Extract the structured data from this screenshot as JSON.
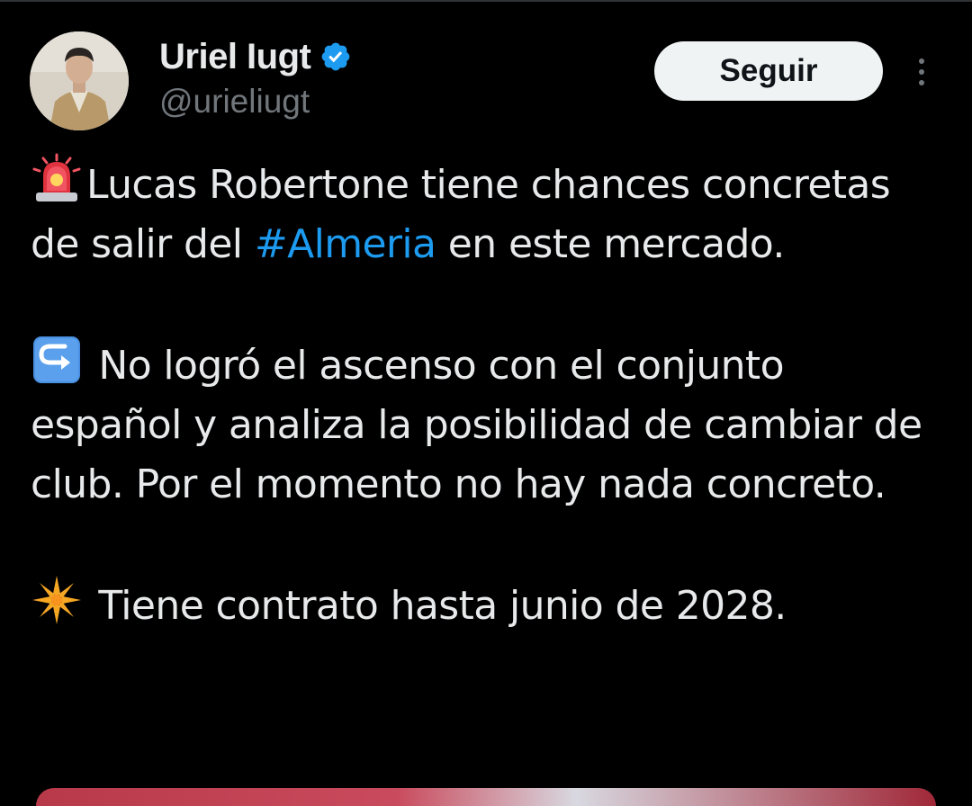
{
  "author": {
    "display_name": "Uriel Iugt",
    "handle": "@urieliugt",
    "verified": true
  },
  "follow_button": {
    "label": "Seguir"
  },
  "more_options": {
    "icon": "more-vertical-icon"
  },
  "tweet": {
    "paragraph_1": {
      "emoji": "police-light-icon",
      "text_before": "Lucas Robertone tiene chances concretas de salir del ",
      "hashtag": "#Almeria",
      "text_after": " en este mercado."
    },
    "paragraph_2": {
      "emoji": "right-arrow-curving-up-icon",
      "text": " No logró el ascenso con el conjunto español y analiza la posibilidad de cambiar de club. Por el momento no hay nada concreto."
    },
    "paragraph_3": {
      "emoji": "eight-pointed-star-icon",
      "text": " Tiene contrato hasta junio de 2028."
    }
  },
  "colors": {
    "background": "#000000",
    "text": "#e7e9ea",
    "secondary_text": "#71767b",
    "hashtag": "#1d9bf0",
    "verified_badge": "#1d9bf0",
    "follow_button_bg": "#eff3f4",
    "follow_button_text": "#0f1419"
  }
}
